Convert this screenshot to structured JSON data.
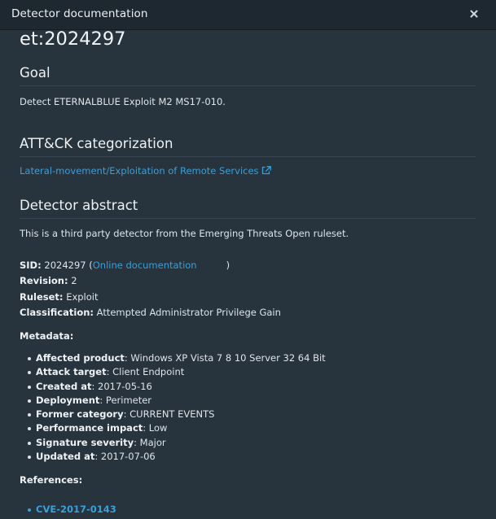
{
  "window": {
    "title": "Detector documentation"
  },
  "detector_id": "et:2024297",
  "goal": {
    "heading": "Goal",
    "text": "Detect ETERNALBLUE Exploit M2 MS17-010."
  },
  "attack": {
    "heading": "ATT&CK categorization",
    "link_text": "Lateral-movement/Exploitation of Remote Services"
  },
  "abstract": {
    "heading": "Detector abstract",
    "text": "This is a third party detector from the Emerging Threats Open ruleset."
  },
  "info": {
    "sid_label": "SID:",
    "sid_value": "2024297 (",
    "online_doc": "Online documentation",
    "sid_close": ")",
    "revision_label": "Revision:",
    "revision_value": "2",
    "ruleset_label": "Ruleset:",
    "ruleset_value": "Exploit",
    "classification_label": "Classification:",
    "classification_value": "Attempted Administrator Privilege Gain"
  },
  "metadata": {
    "heading": "Metadata:",
    "items": [
      {
        "label": "Affected product",
        "value": ": Windows XP Vista 7 8 10 Server 32 64 Bit"
      },
      {
        "label": "Attack target",
        "value": ": Client Endpoint"
      },
      {
        "label": "Created at",
        "value": ": 2017-05-16"
      },
      {
        "label": "Deployment",
        "value": ": Perimeter"
      },
      {
        "label": "Former category",
        "value": ": CURRENT EVENTS"
      },
      {
        "label": "Performance impact",
        "value": ": Low"
      },
      {
        "label": "Signature severity",
        "value": ": Major"
      },
      {
        "label": "Updated at",
        "value": ": 2017-07-06"
      }
    ]
  },
  "references": {
    "heading": "References:",
    "items": [
      "CVE-2017-0143"
    ]
  },
  "icons": {
    "close": "close-icon",
    "external": "external-link-icon"
  },
  "colors": {
    "background": "#27333d",
    "header": "#1d2830",
    "link": "#3aa0d8"
  }
}
